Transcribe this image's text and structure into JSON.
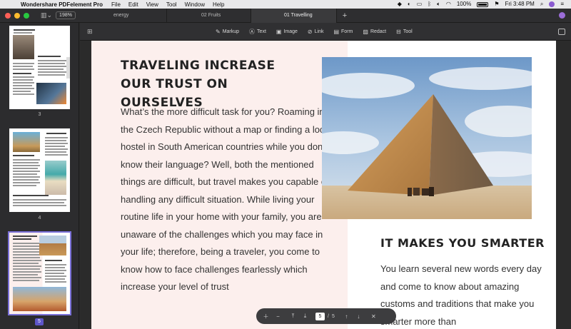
{
  "menubar": {
    "app_name": "Wondershare PDFelement Pro",
    "menus": [
      "File",
      "Edit",
      "View",
      "Tool",
      "Window",
      "Help"
    ],
    "battery": "100%",
    "clock": "Fri 3:48 PM"
  },
  "toolbar": {
    "zoom": "198%",
    "tabs": [
      {
        "label": "energy"
      },
      {
        "label": "02 Fruits"
      },
      {
        "label": "01 Travelling"
      }
    ],
    "add_tab": "+"
  },
  "tools": [
    {
      "icon": "pen-icon",
      "label": "Markup"
    },
    {
      "icon": "text-icon",
      "label": "Text"
    },
    {
      "icon": "image-icon",
      "label": "Image"
    },
    {
      "icon": "link-icon",
      "label": "Link"
    },
    {
      "icon": "form-icon",
      "label": "Form"
    },
    {
      "icon": "redact-icon",
      "label": "Redact"
    },
    {
      "icon": "toolbox-icon",
      "label": "Tool"
    }
  ],
  "thumbnails": [
    {
      "page": "3"
    },
    {
      "page": "4"
    },
    {
      "page": "5"
    }
  ],
  "document": {
    "heading_left": "TRAVELING INCREASE OUR TRUST ON OURSELVES",
    "paragraph_left": "What’s the more difficult task for you? Roaming in the Czech Republic without a map or finding a local hostel in South American countries while you don’t know their language? Well, both the mentioned things are difficult, but travel makes you capable of handling any difficult situation. While living your routine life in your home with your family, you are unaware of the challenges which you may face in your life; therefore, being a traveler, you come to know how to face challenges fearlessly which increase your level of trust",
    "heading_right": "IT MAKES YOU SMARTER",
    "paragraph_right": "You learn several new words every day and come to know about amazing customs and traditions that make you smarter more than"
  },
  "page_nav": {
    "current_page": "5",
    "separator": "/",
    "total_pages": "5"
  },
  "colors": {
    "accent": "#5d55c8",
    "page_left_bg": "#fcefed"
  }
}
